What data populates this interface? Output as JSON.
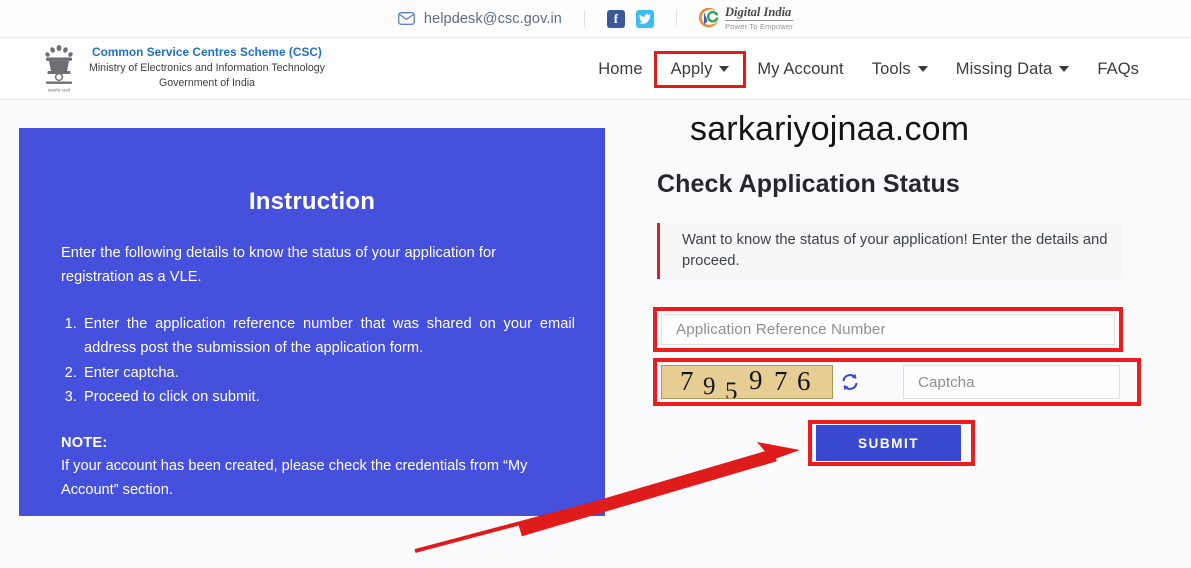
{
  "topbar": {
    "email": "helpdesk@csc.gov.in",
    "mail_icon": "envelope-icon",
    "facebook_glyph": "f",
    "digital_india": {
      "title": "Digital India",
      "tagline": "Power To Empower"
    }
  },
  "brand": {
    "line1": "Common Service Centres Scheme (CSC)",
    "line2": "Ministry of Electronics and Information Technology",
    "line3": "Government of India",
    "emblem_icon": "national-emblem-icon"
  },
  "nav": {
    "items": [
      {
        "label": "Home",
        "caret": false,
        "highlighted": false
      },
      {
        "label": "Apply",
        "caret": true,
        "highlighted": true
      },
      {
        "label": "My Account",
        "caret": false,
        "highlighted": false
      },
      {
        "label": "Tools",
        "caret": true,
        "highlighted": false
      },
      {
        "label": "Missing Data",
        "caret": true,
        "highlighted": false
      },
      {
        "label": "FAQs",
        "caret": false,
        "highlighted": false
      }
    ]
  },
  "instruction": {
    "title": "Instruction",
    "lead": "Enter the following details to know the status of your application for registration as a VLE.",
    "steps": [
      "Enter the application reference number that was shared on your email address post the submission of the application form.",
      "Enter captcha.",
      "Proceed to click on submit."
    ],
    "note_label": "NOTE:",
    "note_text": "If your account has been created, please check the credentials from “My Account” section."
  },
  "watermark": "sarkariyojnaa.com",
  "form": {
    "title": "Check Application Status",
    "callout": "Want to know the status of your application! Enter the details and proceed.",
    "arn_placeholder": "Application Reference Number",
    "arn_value": "",
    "captcha_code": "795976",
    "captcha_digits": [
      "7",
      "9",
      "5",
      "9",
      "7",
      "6"
    ],
    "refresh_icon": "refresh-icon",
    "captcha_placeholder": "Captcha",
    "captcha_value": "",
    "submit_label": "SUBMIT"
  },
  "colors": {
    "panel_blue": "#4550dc",
    "button_blue": "#3a4ad0",
    "highlight_red": "#ee1c1c",
    "callout_accent": "#cf2130",
    "captcha_bg": "#e6cd94",
    "brand_blue": "#1f6fc4"
  },
  "annotations": {
    "arrow": "red-arrow-pointing-to-submit"
  }
}
